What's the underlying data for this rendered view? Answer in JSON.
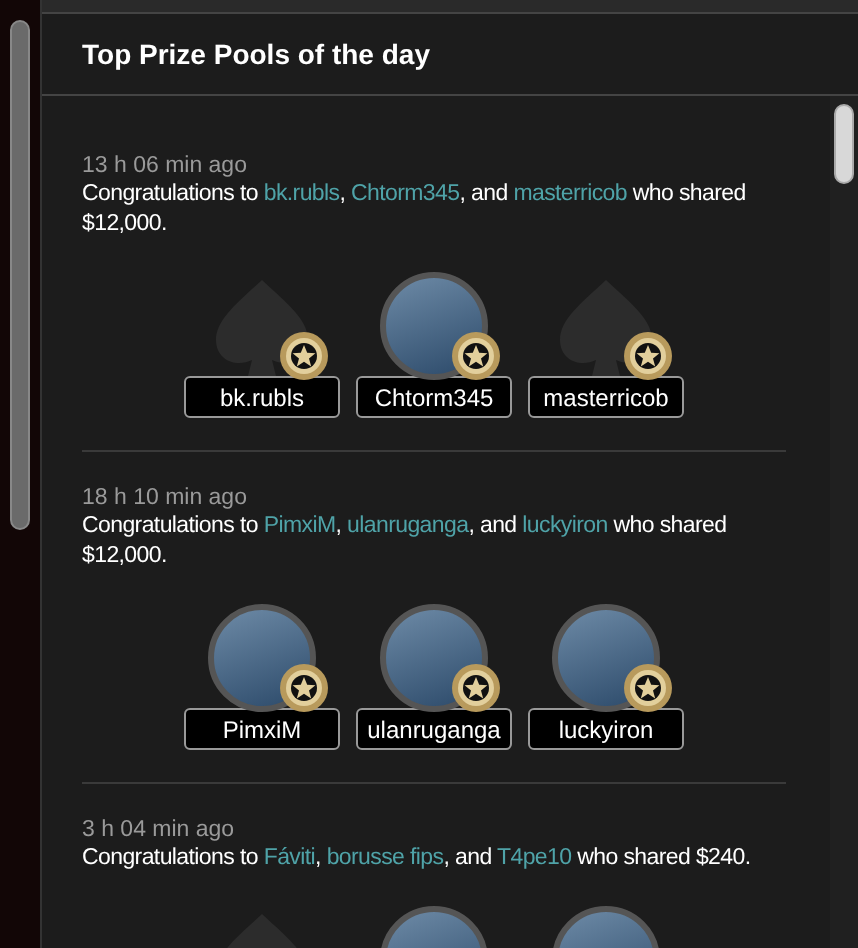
{
  "title": "Top Prize Pools of the day",
  "entries": [
    {
      "time": "13 h 06 min ago",
      "message": [
        {
          "kind": "text",
          "text": "Congratulations to "
        },
        {
          "kind": "link",
          "text": "bk.rubls"
        },
        {
          "kind": "text",
          "text": ", "
        },
        {
          "kind": "link",
          "text": "Chtorm345"
        },
        {
          "kind": "text",
          "text": ", and "
        },
        {
          "kind": "link",
          "text": "masterricob"
        },
        {
          "kind": "text",
          "text": " who shared $12,000."
        }
      ],
      "winners": [
        {
          "name": "bk.rubls",
          "kind": "placeholder"
        },
        {
          "name": "Chtorm345",
          "kind": "photo"
        },
        {
          "name": "masterricob",
          "kind": "placeholder"
        }
      ]
    },
    {
      "time": "18 h 10 min ago",
      "message": [
        {
          "kind": "text",
          "text": "Congratulations to "
        },
        {
          "kind": "link",
          "text": "PimxiM"
        },
        {
          "kind": "text",
          "text": ", "
        },
        {
          "kind": "link",
          "text": "ulanruganga"
        },
        {
          "kind": "text",
          "text": ", and "
        },
        {
          "kind": "link",
          "text": "luckyiron"
        },
        {
          "kind": "text",
          "text": " who shared $12,000."
        }
      ],
      "winners": [
        {
          "name": "PimxiM",
          "kind": "photo"
        },
        {
          "name": "ulanruganga",
          "kind": "photo"
        },
        {
          "name": "luckyiron",
          "kind": "photo"
        }
      ]
    },
    {
      "time": "3 h 04 min ago",
      "message": [
        {
          "kind": "text",
          "text": "Congratulations to "
        },
        {
          "kind": "link",
          "text": "Fáviti"
        },
        {
          "kind": "text",
          "text": ", "
        },
        {
          "kind": "link",
          "text": "borusse fips"
        },
        {
          "kind": "text",
          "text": ", and "
        },
        {
          "kind": "link",
          "text": "T4pe10"
        },
        {
          "kind": "text",
          "text": " who shared $240."
        }
      ],
      "winners": [
        {
          "kind": "placeholder"
        },
        {
          "kind": "photo"
        },
        {
          "kind": "photo"
        }
      ]
    }
  ]
}
